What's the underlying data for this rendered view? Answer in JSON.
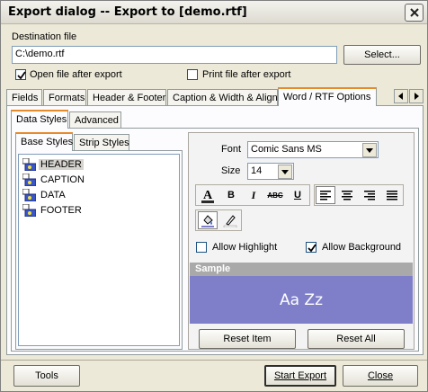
{
  "window": {
    "title": "Export dialog -- Export to [demo.rtf]"
  },
  "destination": {
    "label": "Destination file",
    "value": "C:\\demo.rtf",
    "select_label": "Select...",
    "open_after_export_label": "Open file after export",
    "open_after_export_checked": true,
    "print_after_export_label": "Print file after export",
    "print_after_export_checked": false
  },
  "main_tabs": {
    "items": [
      "Fields",
      "Formats",
      "Header & Footer",
      "Caption & Width & Align",
      "Word / RTF Options"
    ],
    "active": "Word / RTF Options"
  },
  "sub_tabs": {
    "items": [
      "Data Styles",
      "Advanced"
    ],
    "active": "Data Styles"
  },
  "style_tabs": {
    "items": [
      "Base Styles",
      "Strip Styles"
    ],
    "active": "Base Styles"
  },
  "style_tree": {
    "items": [
      "HEADER",
      "CAPTION",
      "DATA",
      "FOOTER"
    ],
    "selected": "HEADER"
  },
  "font": {
    "font_label": "Font",
    "font_value": "Comic Sans MS",
    "size_label": "Size",
    "size_value": "14"
  },
  "toolbar": {
    "font_color_icon": "font-color-icon",
    "bold": "B",
    "italic": "I",
    "strike": "ABC",
    "underline": "U"
  },
  "options": {
    "allow_highlight_label": "Allow Highlight",
    "allow_highlight_checked": false,
    "allow_background_label": "Allow Background",
    "allow_background_checked": true
  },
  "sample": {
    "header": "Sample",
    "text": "Aa Zz",
    "background_color": "#7f7fc9",
    "text_color": "#ffffff"
  },
  "buttons": {
    "reset_item": "Reset Item",
    "reset_all": "Reset All",
    "tools": "Tools",
    "start_export": "Start Export",
    "close": "Close"
  },
  "colors": {
    "active_tab_accent": "#e68b2c",
    "sample_header": "#a9a9a9"
  }
}
